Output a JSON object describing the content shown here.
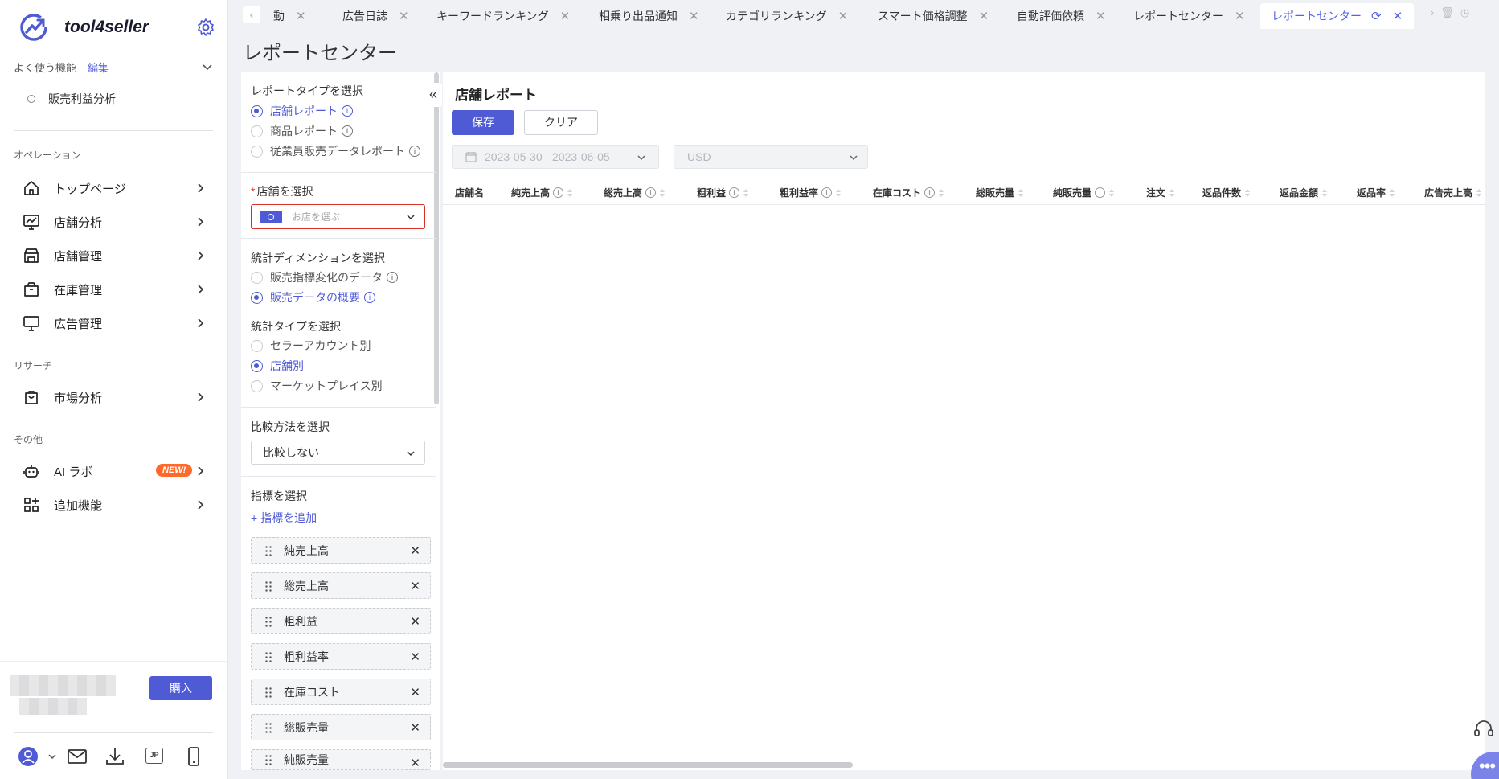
{
  "app": {
    "brand": "tool4seller"
  },
  "sidebar": {
    "favorites_label": "よく使う機能",
    "favorites_edit": "編集",
    "favorite_items": [
      "販売利益分析"
    ],
    "sections": {
      "operations": "オペレーション",
      "research": "リサーチ",
      "other": "その他"
    },
    "nav": {
      "top_page": "トップページ",
      "store_analysis": "店舗分析",
      "store_management": "店舗管理",
      "inventory": "在庫管理",
      "ads": "広告管理",
      "market_analysis": "市場分析",
      "ai_lab": "AI ラボ",
      "ai_lab_badge": "NEW!",
      "add_features": "追加機能"
    },
    "buy_label": "購入",
    "lang_badge": "JP"
  },
  "tabs": {
    "items": [
      {
        "label": "動"
      },
      {
        "label": "広告日誌"
      },
      {
        "label": "キーワードランキング"
      },
      {
        "label": "相乗り出品通知"
      },
      {
        "label": "カテゴリランキング"
      },
      {
        "label": "スマート価格調整"
      },
      {
        "label": "自動評価依頼"
      },
      {
        "label": "レポートセンター"
      }
    ],
    "active": "レポートセンター"
  },
  "page": {
    "title": "レポートセンター"
  },
  "config": {
    "report_type_label": "レポートタイプを選択",
    "report_types": [
      "店舗レポート",
      "商品レポート",
      "従業員販売データレポート"
    ],
    "report_type_selected": "店舗レポート",
    "store_label": "店舗を選択",
    "store_placeholder": "お店を選ぶ",
    "dimension_label": "統計ディメンションを選択",
    "dimensions": [
      "販売指標変化のデータ",
      "販売データの概要"
    ],
    "dimension_selected": "販売データの概要",
    "stat_type_label": "統計タイプを選択",
    "stat_types": [
      "セラーアカウント別",
      "店舗別",
      "マーケットプレイス別"
    ],
    "stat_type_selected": "店舗別",
    "compare_label": "比較方法を選択",
    "compare_value": "比較しない",
    "metrics_label": "指標を選択",
    "add_metric": "+ 指標を追加",
    "metrics": [
      "純売上高",
      "総売上高",
      "粗利益",
      "粗利益率",
      "在庫コスト",
      "総販売量",
      "純販売量"
    ]
  },
  "report": {
    "title": "店舗レポート",
    "save_label": "保存",
    "clear_label": "クリア",
    "date_range": "2023-05-30 - 2023-06-05",
    "currency": "USD",
    "columns": [
      "店舗名",
      "純売上高",
      "総売上高",
      "粗利益",
      "粗利益率",
      "在庫コスト",
      "総販売量",
      "純販売量",
      "注文",
      "返品件数",
      "返品金額",
      "返品率",
      "広告売上高"
    ],
    "rows": []
  },
  "colors": {
    "accent": "#4f5bd5",
    "badge": "#ff6a2b",
    "required": "#d93025"
  }
}
